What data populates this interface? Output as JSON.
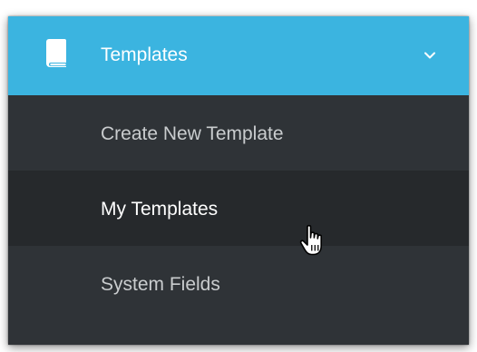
{
  "header": {
    "icon": "book-icon",
    "label": "Templates",
    "chevron": "chevron-down-icon",
    "background": "#3bb4e0"
  },
  "menu": {
    "items": [
      {
        "label": "Create New Template",
        "active": false
      },
      {
        "label": "My Templates",
        "active": true
      },
      {
        "label": "System Fields",
        "active": false
      }
    ],
    "background": "#2f3337",
    "active_background": "#26292c"
  },
  "pointer": {
    "icon": "hand-pointer-icon"
  }
}
